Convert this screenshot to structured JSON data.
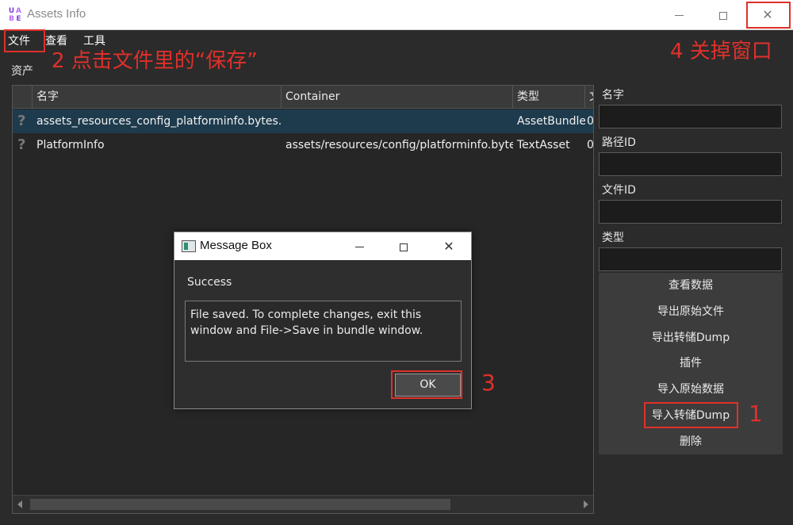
{
  "window": {
    "title": "Assets Info",
    "logo_letters": [
      "U",
      "A",
      "B",
      "E"
    ],
    "minimize_glyph": "",
    "close_glyph": "✕"
  },
  "menu": {
    "file": "文件",
    "view": "查看",
    "tools": "工具"
  },
  "assets_label": "资产",
  "table": {
    "headers": {
      "name": "名字",
      "container": "Container",
      "type": "类型",
      "extra": "文"
    },
    "rows": [
      {
        "icon": "?",
        "name": "assets_resources_config_platforminfo.bytes.ab",
        "container": "",
        "type": "AssetBundle",
        "extra": "0"
      },
      {
        "icon": "?",
        "name": "PlatformInfo",
        "container": "assets/resources/config/platforminfo.bytes",
        "type": "TextAsset",
        "extra": "0"
      }
    ]
  },
  "side_panel": {
    "name_label": "名字",
    "path_id_label": "路径ID",
    "file_id_label": "文件ID",
    "type_label": "类型",
    "buttons": {
      "view_data": "查看数据",
      "export_raw": "导出原始文件",
      "export_dump": "导出转储Dump",
      "plugins": "插件",
      "import_raw": "导入原始数据",
      "import_dump": "导入转储Dump",
      "delete": "删除"
    }
  },
  "dialog": {
    "title": "Message Box",
    "heading": "Success",
    "message": "File saved. To complete changes, exit this window and File->Save in bundle window.",
    "ok_label": "OK"
  },
  "annotations": {
    "step1": "1",
    "step2": "2 点击文件里的“保存”",
    "step3": "3",
    "step4": "4 关掉窗口",
    "color": "#e0302a"
  },
  "colors": {
    "background": "#2b2b2b",
    "selected_row": "#1e3b4d",
    "button_panel": "#3c3c3c"
  }
}
